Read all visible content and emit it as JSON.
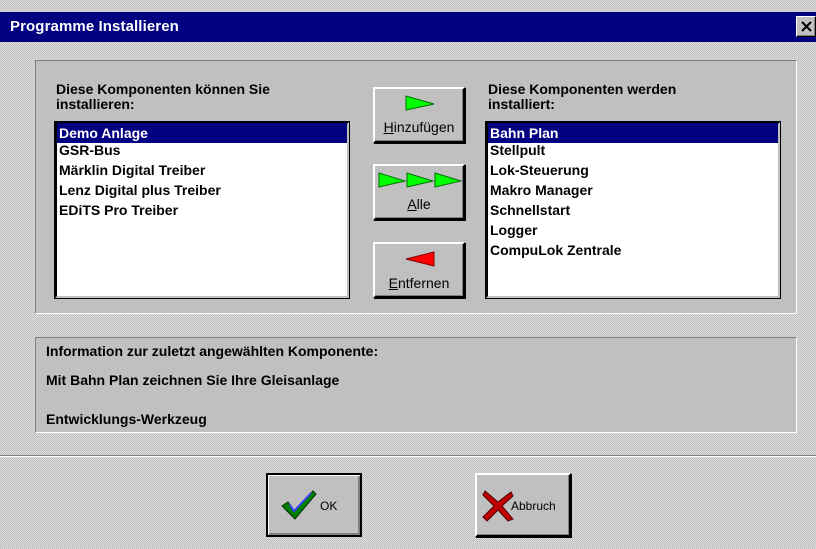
{
  "window": {
    "title": "Programme Installieren"
  },
  "available": {
    "label_line1": "Diese Komponenten können Sie",
    "label_line2": "installieren:",
    "items": [
      "Demo Anlage",
      "GSR-Bus",
      "Märklin Digital Treiber",
      "Lenz Digital plus Treiber",
      "EDiTS Pro Treiber"
    ],
    "selected": "Demo Anlage"
  },
  "installed": {
    "label_line1": "Diese Komponenten werden",
    "label_line2": "installiert:",
    "items": [
      "Bahn Plan",
      "Stellpult",
      "Lok-Steuerung",
      "Makro Manager",
      "Schnellstart",
      "Logger",
      "CompuLok Zentrale"
    ],
    "selected": "Bahn Plan"
  },
  "buttons": {
    "add_prefix": "H",
    "add_rest": "inzufügen",
    "all_prefix": "A",
    "all_rest": "lle",
    "remove_prefix": "E",
    "remove_rest": "ntfernen",
    "ok": "OK",
    "cancel": "Abbruch"
  },
  "info": {
    "heading": "Information zur zuletzt angewählten Komponente:",
    "description": "Mit Bahn Plan zeichnen Sie Ihre Gleisanlage",
    "category": "Entwicklungs-Werkzeug"
  },
  "colors": {
    "titlebar": "#000080",
    "selection": "#000080",
    "arrow_green": "#00ff00",
    "arrow_red": "#ff0000",
    "check_green": "#008000",
    "cross_red": "#c00000"
  },
  "icons": {
    "close": "close-icon",
    "add": "green-arrow-right-icon",
    "all": "triple-green-arrow-right-icon",
    "remove": "red-arrow-left-icon",
    "ok": "green-checkmark-icon",
    "cancel": "red-cross-icon"
  }
}
